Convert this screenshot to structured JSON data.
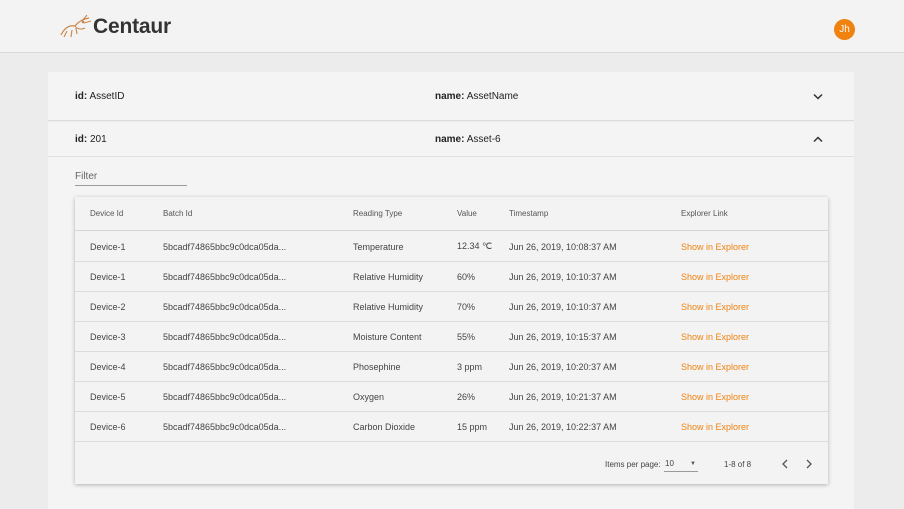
{
  "app": {
    "name": "Centaur",
    "avatar_initials": "Jh"
  },
  "colors": {
    "accent": "#f0820f"
  },
  "header_row": {
    "id_label": "id:",
    "id_value": "AssetID",
    "name_label": "name:",
    "name_value": "AssetName",
    "chevron": "chevron-down-icon"
  },
  "asset": {
    "id_label": "id:",
    "id_value": "201",
    "name_label": "name:",
    "name_value": "Asset-6",
    "chevron": "chevron-up-icon"
  },
  "filter": {
    "placeholder": "Filter"
  },
  "table": {
    "columns": [
      "Device Id",
      "Batch Id",
      "Reading Type",
      "Value",
      "Timestamp",
      "Explorer Link"
    ],
    "rows": [
      [
        "Device-1",
        "5bcadf74865bbc9c0dca05da...",
        "Temperature",
        "12.34 ℃",
        "Jun 26, 2019, 10:08:37 AM",
        "Show in Explorer"
      ],
      [
        "Device-1",
        "5bcadf74865bbc9c0dca05da...",
        "Relative Humidity",
        "60%",
        "Jun 26, 2019, 10:10:37 AM",
        "Show in Explorer"
      ],
      [
        "Device-2",
        "5bcadf74865bbc9c0dca05da...",
        "Relative Humidity",
        "70%",
        "Jun 26, 2019, 10:10:37 AM",
        "Show in Explorer"
      ],
      [
        "Device-3",
        "5bcadf74865bbc9c0dca05da...",
        "Moisture Content",
        "55%",
        "Jun 26, 2019, 10:15:37 AM",
        "Show in Explorer"
      ],
      [
        "Device-4",
        "5bcadf74865bbc9c0dca05da...",
        "Phosephine",
        "3 ppm",
        "Jun 26, 2019, 10:20:37 AM",
        "Show in Explorer"
      ],
      [
        "Device-5",
        "5bcadf74865bbc9c0dca05da...",
        "Oxygen",
        "26%",
        "Jun 26, 2019, 10:21:37 AM",
        "Show in Explorer"
      ],
      [
        "Device-6",
        "5bcadf74865bbc9c0dca05da...",
        "Carbon Dioxide",
        "15 ppm",
        "Jun 26, 2019, 10:22:37 AM",
        "Show in Explorer"
      ]
    ]
  },
  "paginator": {
    "items_per_page_label": "Items per page:",
    "items_per_page": "10",
    "range": "1-8 of 8",
    "prev_icon": "chevron-left-icon",
    "next_icon": "chevron-right-icon"
  }
}
